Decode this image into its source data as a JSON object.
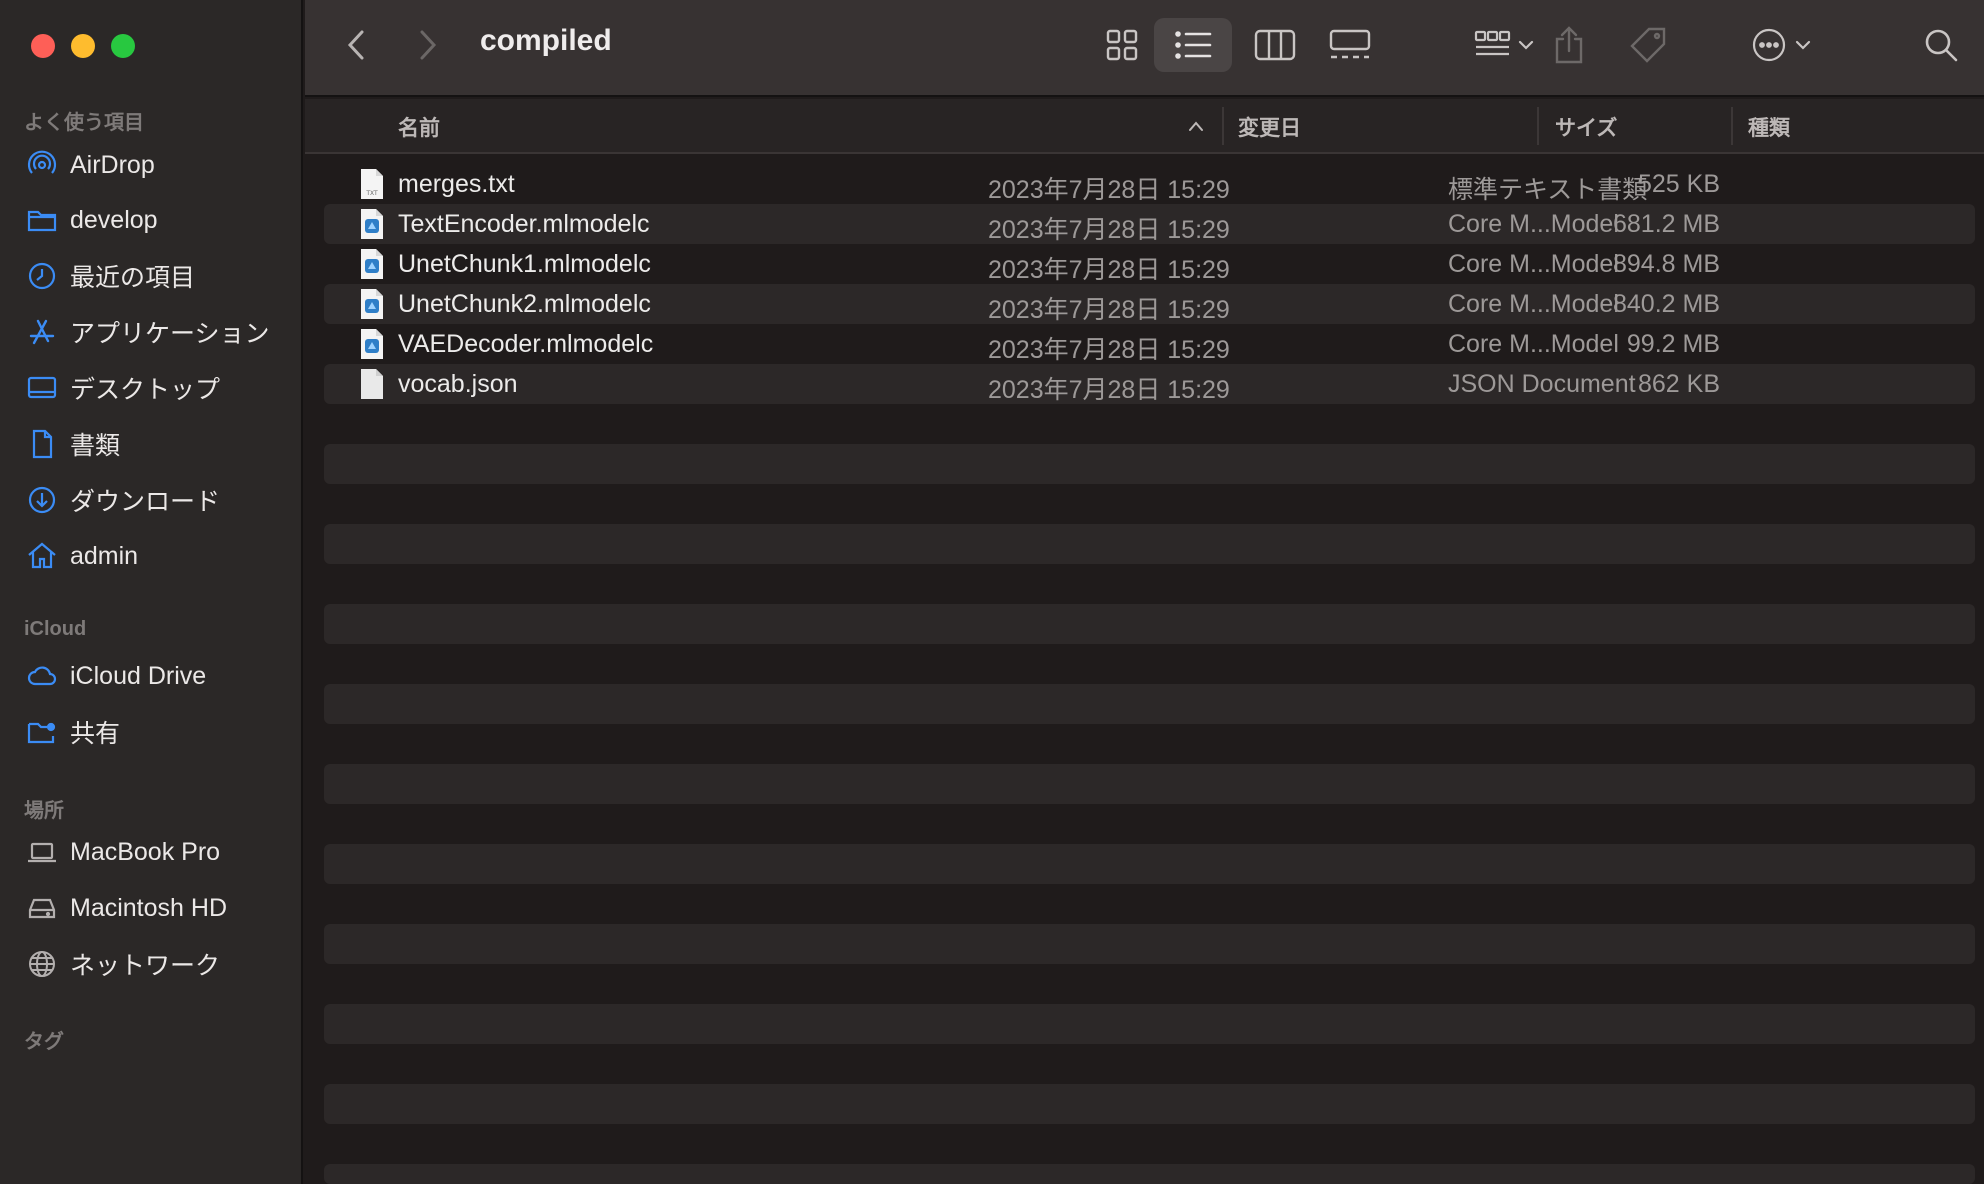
{
  "window": {
    "title": "compiled"
  },
  "sidebar": {
    "sections": {
      "favorites": "よく使う項目",
      "icloud": "iCloud",
      "locations": "場所",
      "tags": "タグ"
    },
    "favorites": [
      {
        "label": "AirDrop",
        "icon": "airdrop-icon"
      },
      {
        "label": "develop",
        "icon": "folder-icon"
      },
      {
        "label": "最近の項目",
        "icon": "clock-icon"
      },
      {
        "label": "アプリケーション",
        "icon": "applications-icon"
      },
      {
        "label": "デスクトップ",
        "icon": "desktop-icon"
      },
      {
        "label": "書類",
        "icon": "document-icon"
      },
      {
        "label": "ダウンロード",
        "icon": "download-icon"
      },
      {
        "label": "admin",
        "icon": "home-icon"
      }
    ],
    "icloud": [
      {
        "label": "iCloud Drive",
        "icon": "cloud-icon"
      },
      {
        "label": "共有",
        "icon": "shared-folder-icon"
      }
    ],
    "locations": [
      {
        "label": "MacBook Pro",
        "icon": "laptop-icon"
      },
      {
        "label": "Macintosh HD",
        "icon": "disk-icon"
      },
      {
        "label": "ネットワーク",
        "icon": "globe-icon"
      }
    ]
  },
  "columns": {
    "name": "名前",
    "date": "変更日",
    "size": "サイズ",
    "kind": "種類"
  },
  "files": [
    {
      "name": "merges.txt",
      "date": "2023年7月28日 15:29",
      "size": "525 KB",
      "kind": "標準テキスト書類",
      "icon": "text-file-icon"
    },
    {
      "name": "TextEncoder.mlmodelc",
      "date": "2023年7月28日 15:29",
      "size": "681.2 MB",
      "kind": "Core M...Model",
      "icon": "mlmodel-icon"
    },
    {
      "name": "UnetChunk1.mlmodelc",
      "date": "2023年7月28日 15:29",
      "size": "894.8 MB",
      "kind": "Core M...Model",
      "icon": "mlmodel-icon"
    },
    {
      "name": "UnetChunk2.mlmodelc",
      "date": "2023年7月28日 15:29",
      "size": "840.2 MB",
      "kind": "Core M...Model",
      "icon": "mlmodel-icon"
    },
    {
      "name": "VAEDecoder.mlmodelc",
      "date": "2023年7月28日 15:29",
      "size": "99.2 MB",
      "kind": "Core M...Model",
      "icon": "mlmodel-icon"
    },
    {
      "name": "vocab.json",
      "date": "2023年7月28日 15:29",
      "size": "862 KB",
      "kind": "JSON Document",
      "icon": "json-file-icon"
    }
  ],
  "colors": {
    "accent": "#3b8cf5",
    "sidebar_bg": "#2b2827",
    "list_bg": "#1f1b1b",
    "stripe": "#2c2828"
  }
}
